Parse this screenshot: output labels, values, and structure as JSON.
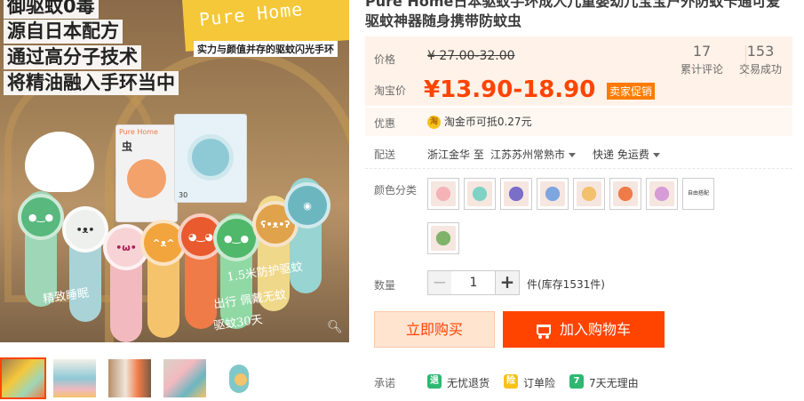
{
  "gallery": {
    "promo_lines": [
      "御驱蚊0毒",
      "源自日本配方",
      "通过高分子技术",
      "将精油融入手环当中"
    ],
    "brand": "Pure Home",
    "brand_sub": "实力与颜值并存的驱蚊闪光手环",
    "handwritten": [
      "1.5米防护驱蚊",
      "精致睡眠",
      "出行 佩戴无蚊",
      "驱蚊30天"
    ],
    "box_label": "Pure Home",
    "box_char": "虫",
    "box_number": "30"
  },
  "product": {
    "title": "Pure Home日本驱蚊手环成人儿童婴幼儿宝宝户外防蚊卡通可爱驱蚊神器随身携带防蚊虫"
  },
  "price": {
    "original_label": "价格",
    "original_value": "¥ 27.00-32.00",
    "sale_label": "淘宝价",
    "sale_value": "¥13.90-18.90",
    "promo_tag": "卖家促销",
    "reviews_count": "17",
    "reviews_label": "累计评论",
    "deals_count": "153",
    "deals_label": "交易成功"
  },
  "discount": {
    "label": "优惠",
    "coin_icon": "coin-icon",
    "coin_glyph": "淘",
    "text": "淘金币可抵",
    "amount": "0.27元"
  },
  "shipping": {
    "label": "配送",
    "from": "浙江金华 至",
    "to": "江苏苏州常熟市",
    "method": "快递 免运费"
  },
  "colors": {
    "label": "颜色分类",
    "swatches": [
      "#f5b3b8",
      "#7fd3c4",
      "#7a6ec9",
      "#7da6e0",
      "#f2c16c",
      "#ef7b48",
      "#d79bd8",
      "#ffffff",
      "#7fb36a"
    ],
    "swatch_9_text": "自由搭配"
  },
  "quantity": {
    "label": "数量",
    "minus": "−",
    "value": "1",
    "plus": "+",
    "stock": "件(库存1531件)"
  },
  "actions": {
    "buy_now": "立即购买",
    "add_cart": "加入购物车"
  },
  "promise": {
    "label": "承诺",
    "items": [
      {
        "icon": "truck-icon",
        "glyph": "退",
        "text": "无忧退货",
        "color": "#2eb872"
      },
      {
        "icon": "shield-icon",
        "glyph": "险",
        "text": "订单险",
        "color": "#f8c11c"
      },
      {
        "icon": "seven-day-icon",
        "glyph": "7",
        "text": "7天无理由",
        "color": "#2eb872"
      }
    ]
  },
  "accent_color": "#ff4400"
}
